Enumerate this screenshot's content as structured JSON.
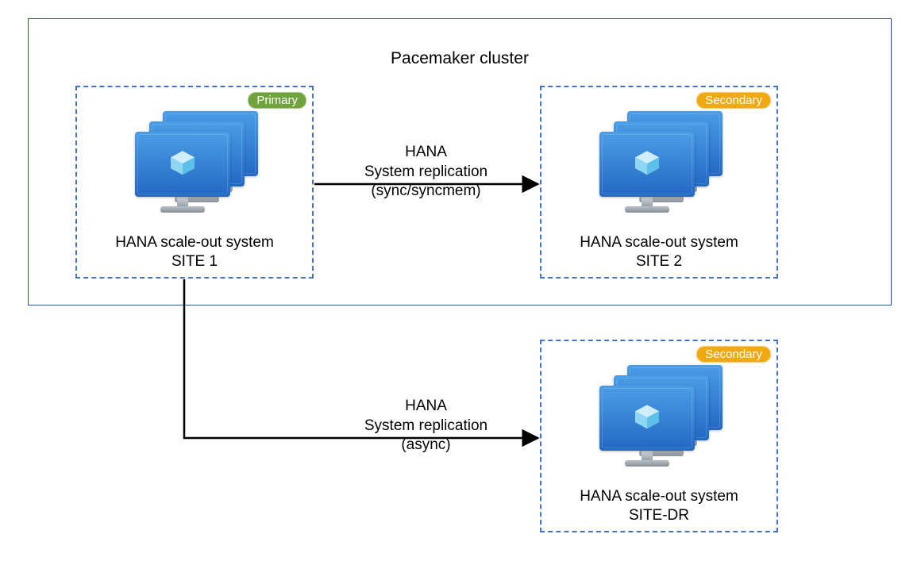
{
  "cluster": {
    "title": "Pacemaker cluster"
  },
  "sites": {
    "site1": {
      "badge": "Primary",
      "caption_line1": "HANA scale-out system",
      "caption_line2": "SITE 1"
    },
    "site2": {
      "badge": "Secondary",
      "caption_line1": "HANA scale-out system",
      "caption_line2": "SITE 2"
    },
    "sitedr": {
      "badge": "Secondary",
      "caption_line1": "HANA scale-out system",
      "caption_line2": "SITE-DR"
    }
  },
  "arrows": {
    "a1": {
      "line1": "HANA",
      "line2": "System replication",
      "line3": "(sync/syncmem)"
    },
    "a2": {
      "line1": "HANA",
      "line2": "System replication",
      "line3": "(async)"
    }
  }
}
